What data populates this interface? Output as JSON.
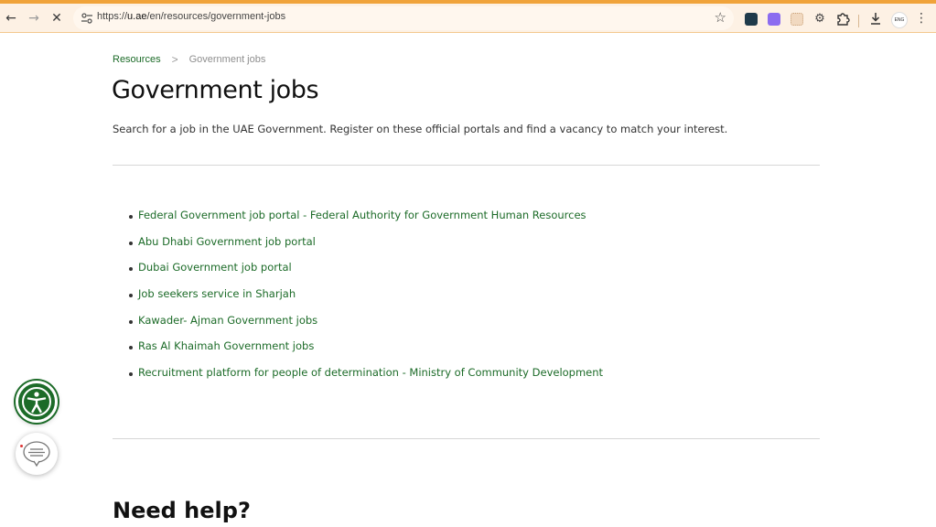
{
  "browser": {
    "url_prefix": "https://",
    "url_host": "u.ae",
    "url_path": "/en/resources/government-jobs",
    "profile_label": "ENG",
    "accent_color": "#f0a33a"
  },
  "breadcrumb": {
    "parent": "Resources",
    "separator": ">",
    "current": "Government jobs"
  },
  "page": {
    "title": "Government jobs",
    "lead": "Search for a job in the UAE Government. Register on these official portals and find a vacancy to match your interest.",
    "links": [
      "Federal Government job portal - Federal Authority for Government Human Resources",
      "Abu Dhabi Government job portal",
      "Dubai Government job portal",
      "Job seekers service in Sharjah",
      "Kawader- Ajman Government jobs",
      "Ras Al Khaimah Government jobs",
      "Recruitment platform for people of determination - Ministry of Community Development"
    ],
    "help_title": "Need help?",
    "link_color": "#1c6b28"
  }
}
